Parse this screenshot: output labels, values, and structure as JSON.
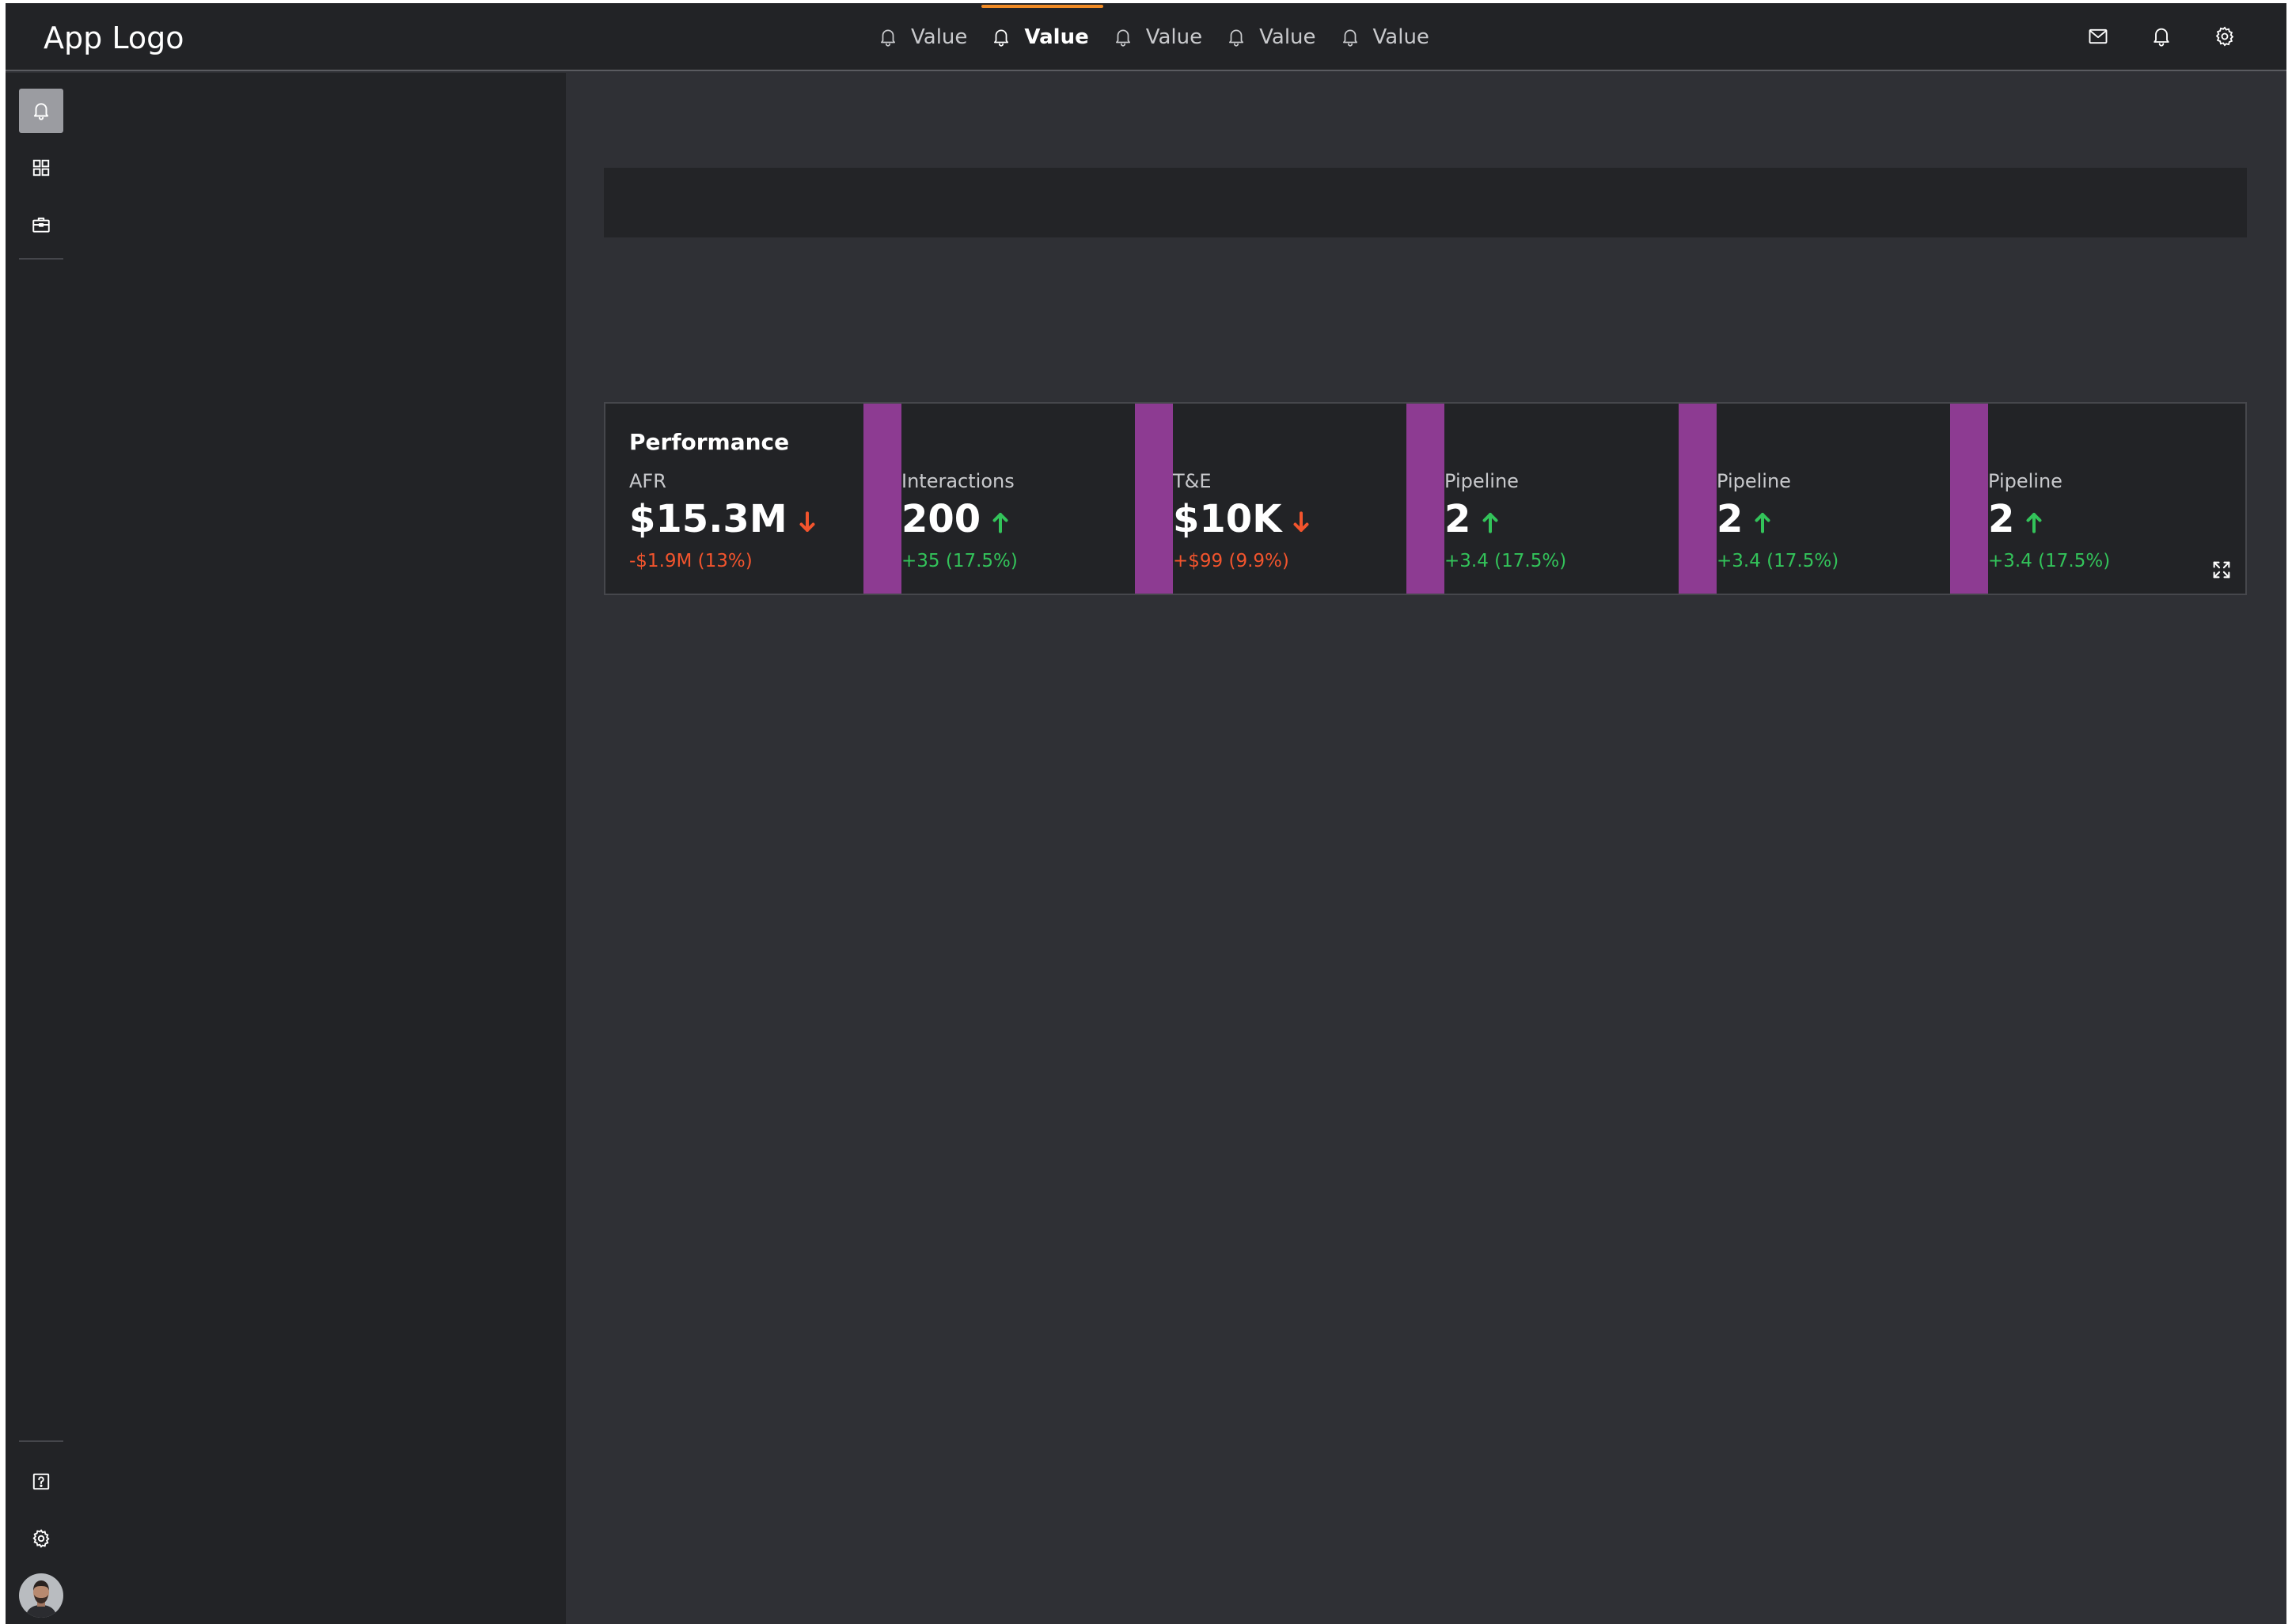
{
  "header": {
    "logo": "App Logo",
    "nav": [
      {
        "label": "Value",
        "active": false,
        "icon": "bell-icon"
      },
      {
        "label": "Value",
        "active": true,
        "icon": "bell-icon"
      },
      {
        "label": "Value",
        "active": false,
        "icon": "bell-icon"
      },
      {
        "label": "Value",
        "active": false,
        "icon": "bell-icon"
      },
      {
        "label": "Value",
        "active": false,
        "icon": "bell-icon"
      }
    ],
    "actions": [
      "mail-icon",
      "bell-icon",
      "gear-icon"
    ],
    "active_tab_color": "#f08a24"
  },
  "sidebar": {
    "top_items": [
      {
        "icon": "bell-icon",
        "active": true
      },
      {
        "icon": "grid-icon",
        "active": false
      },
      {
        "icon": "briefcase-icon",
        "active": false
      }
    ],
    "bottom_items": [
      {
        "icon": "help-icon"
      },
      {
        "icon": "gear-icon"
      },
      {
        "icon": "avatar"
      }
    ]
  },
  "performance": {
    "title": "Performance",
    "accent_color": "#8d3b92",
    "metrics": [
      {
        "label": "AFR",
        "value": "$15.3M",
        "trend": "down",
        "delta": "-$1.9M (13%)"
      },
      {
        "label": "Interactions",
        "value": "200",
        "trend": "up",
        "delta": "+35 (17.5%)"
      },
      {
        "label": "T&E",
        "value": "$10K",
        "trend": "down",
        "delta": "+$99 (9.9%)"
      },
      {
        "label": "Pipeline",
        "value": "2",
        "trend": "up",
        "delta": "+3.4 (17.5%)"
      },
      {
        "label": "Pipeline",
        "value": "2",
        "trend": "up",
        "delta": "+3.4 (17.5%)"
      },
      {
        "label": "Pipeline",
        "value": "2",
        "trend": "up",
        "delta": "+3.4 (17.5%)"
      }
    ],
    "colors": {
      "down": "#f2542d",
      "up": "#33c35a"
    }
  }
}
